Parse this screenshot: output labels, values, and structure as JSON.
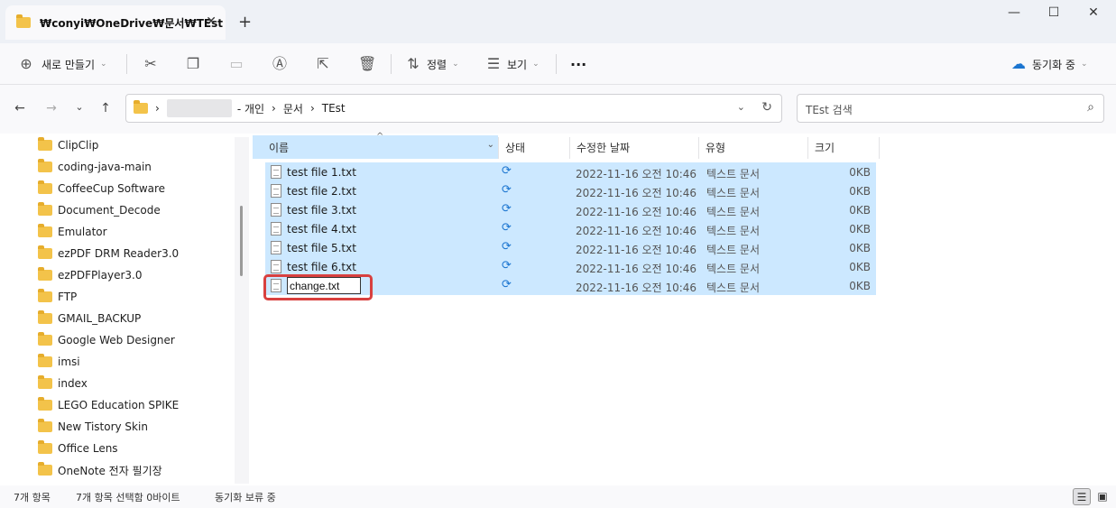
{
  "window": {
    "tab_title": "₩conyi₩OneDrive₩문서₩TEst",
    "tab_close": "✕",
    "new_tab": "+",
    "minimize": "—",
    "maximize": "☐",
    "close": "✕"
  },
  "toolbar": {
    "new_label": "새로 만들기",
    "sort_label": "정렬",
    "view_label": "보기",
    "more_label": "···",
    "sync_label": "동기화 중",
    "icons": [
      "cut-icon",
      "copy-icon",
      "paste-icon",
      "rename-icon",
      "share-icon",
      "delete-icon"
    ]
  },
  "address": {
    "crumbs": [
      "- 개인",
      "문서",
      "TEst"
    ],
    "separator": "›",
    "search_placeholder": "TEst 검색"
  },
  "sidebar": {
    "items": [
      "ClipClip",
      "coding-java-main",
      "CoffeeCup Software",
      "Document_Decode",
      "Emulator",
      "ezPDF DRM Reader3.0",
      "ezPDFPlayer3.0",
      "FTP",
      "GMAIL_BACKUP",
      "Google Web Designer",
      "imsi",
      "index",
      "LEGO Education SPIKE",
      "New Tistory Skin",
      "Office Lens",
      "OneNote 전자 필기장"
    ]
  },
  "columns": {
    "name": "이름",
    "status": "상태",
    "modified": "수정한 날짜",
    "type": "유형",
    "size": "크기"
  },
  "files": [
    {
      "name": "test file 1.txt",
      "date": "2022-11-16 오전 10:46",
      "type": "텍스트 문서",
      "size": "0KB"
    },
    {
      "name": "test file 2.txt",
      "date": "2022-11-16 오전 10:46",
      "type": "텍스트 문서",
      "size": "0KB"
    },
    {
      "name": "test file 3.txt",
      "date": "2022-11-16 오전 10:46",
      "type": "텍스트 문서",
      "size": "0KB"
    },
    {
      "name": "test file 4.txt",
      "date": "2022-11-16 오전 10:46",
      "type": "텍스트 문서",
      "size": "0KB"
    },
    {
      "name": "test file 5.txt",
      "date": "2022-11-16 오전 10:46",
      "type": "텍스트 문서",
      "size": "0KB"
    },
    {
      "name": "test file 6.txt",
      "date": "2022-11-16 오전 10:46",
      "type": "텍스트 문서",
      "size": "0KB"
    }
  ],
  "rename_row": {
    "value": "change.txt",
    "date": "2022-11-16 오전 10:46",
    "type": "텍스트 문서",
    "size": "0KB"
  },
  "statusbar": {
    "count": "7개 항목",
    "selected": "7개 항목 선택함 0바이트",
    "sync": "동기화 보류 중"
  },
  "colors": {
    "selection": "#cce8ff",
    "highlight_border": "#d8403f",
    "sync_icon": "#1b75d0"
  }
}
